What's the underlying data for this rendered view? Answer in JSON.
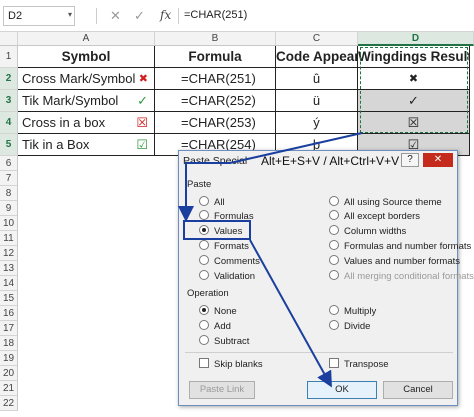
{
  "formula_bar": {
    "name_box": "D2",
    "cancel_icon": "close-icon",
    "enter_icon": "check-icon",
    "fx_label": "fx",
    "formula": "=CHAR(251)"
  },
  "sheet": {
    "columns": [
      "A",
      "B",
      "C",
      "D"
    ],
    "rows": [
      "1",
      "2",
      "3",
      "4",
      "5",
      "6",
      "7",
      "8",
      "9",
      "10",
      "11",
      "12",
      "13",
      "14",
      "15",
      "16",
      "17",
      "18",
      "19",
      "20",
      "21",
      "22"
    ],
    "headers": {
      "symbol": "Symbol",
      "formula": "Formula",
      "code": "Code Appear",
      "result": "Wingdings Result"
    },
    "data": [
      {
        "symbol": "Cross Mark/Symbol",
        "icon": "✖",
        "icon_color": "#d02020",
        "formula": "=CHAR(251)",
        "code": "û",
        "result": "✖"
      },
      {
        "symbol": "Tik Mark/Symbol",
        "icon": "✓",
        "icon_color": "#2e9a3c",
        "formula": "=CHAR(252)",
        "code": "ü",
        "result": "✓"
      },
      {
        "symbol": "Cross in a box",
        "icon": "☒",
        "icon_color": "#d02020",
        "formula": "=CHAR(253)",
        "code": "ý",
        "result": "☒"
      },
      {
        "symbol": "Tik in a Box",
        "icon": "☑",
        "icon_color": "#2e9a3c",
        "formula": "=CHAR(254)",
        "code": "þ",
        "result": "☑"
      }
    ]
  },
  "dialog": {
    "title": "Paste Special",
    "shortcut": "Alt+E+S+V / Alt+Ctrl+V+V",
    "help": "?",
    "close": "✕",
    "paste_label": "Paste",
    "paste_left": [
      "All",
      "Formulas",
      "Values",
      "Formats",
      "Comments",
      "Validation"
    ],
    "paste_right": [
      "All using Source theme",
      "All except borders",
      "Column widths",
      "Formulas and number formats",
      "Values and number formats",
      "All merging conditional formats"
    ],
    "selected_paste": "Values",
    "operation_label": "Operation",
    "op_left": [
      "None",
      "Add",
      "Subtract"
    ],
    "op_right": [
      "Multiply",
      "Divide"
    ],
    "skip_blanks": "Skip blanks",
    "transpose": "Transpose",
    "paste_link": "Paste Link",
    "ok": "OK",
    "cancel": "Cancel"
  },
  "colors": {
    "accent": "#217346",
    "annotation": "#1b3f9e",
    "cross": "#d02020",
    "tick": "#2e9a3c"
  }
}
